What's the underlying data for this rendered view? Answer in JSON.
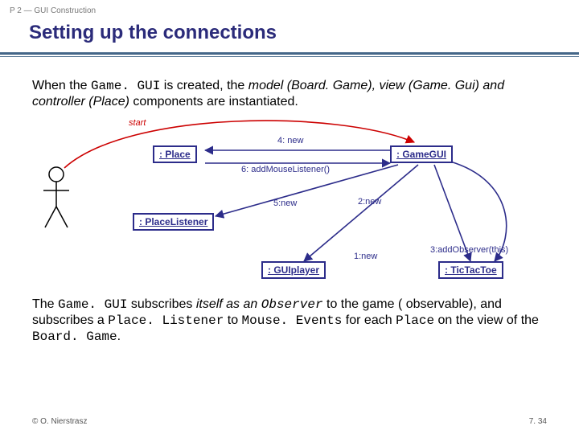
{
  "header": {
    "breadcrumb": "P 2 — GUI Construction",
    "title": "Setting up the connections"
  },
  "para1": {
    "t1": "When the ",
    "code1": "Game. GUI",
    "t2": " is created, the ",
    "ital1": "model (Board. Game), view (Game. Gui) and controller (Place)",
    "t3": " components are instantiated."
  },
  "diagram": {
    "start": "start",
    "box_place": ": Place",
    "box_gamegui": ": GameGUI",
    "box_placelistener": ": PlaceListener",
    "box_guiplayer": ": GUIplayer",
    "box_tictactoe": ": TicTacToe",
    "lbl_4new": "4: new",
    "lbl_6addml": "6: addMouseListener()",
    "lbl_5new": "5:new",
    "lbl_2new": "2:new",
    "lbl_1new": "1:new",
    "lbl_3addobs": "3:addObserver(this)"
  },
  "para2": {
    "t1": "The ",
    "code1": "Game. GUI",
    "t2": " subscribes ",
    "ital1": "itself as an ",
    "code2": "Observer",
    "t3": " to the game ( observable), and subscribes a ",
    "code3": "Place. Listener",
    "t4": " to ",
    "code4": "Mouse. Events",
    "t5": " for each ",
    "code5": "Place",
    "t6": " on the view of the ",
    "code6": "Board. Game",
    "t7": "."
  },
  "footer": {
    "copyright": "© O. Nierstrasz",
    "page": "7. 34"
  }
}
